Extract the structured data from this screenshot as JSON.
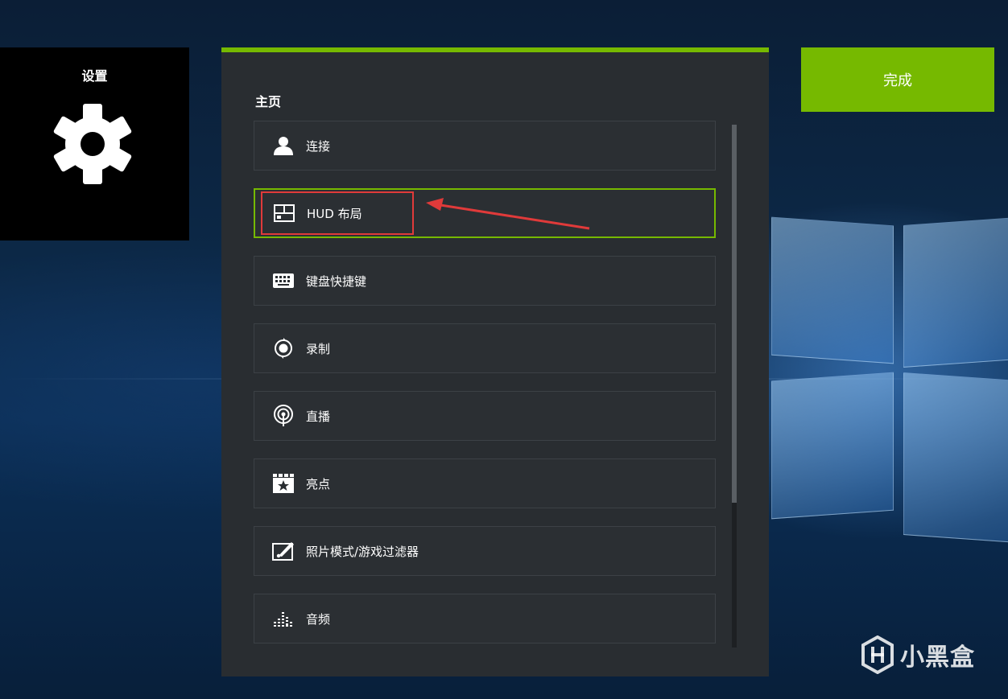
{
  "settings_tile": {
    "title": "设置",
    "icon": "gear-icon"
  },
  "done_button": {
    "label": "完成"
  },
  "panel": {
    "title": "主页",
    "accent_color": "#76b900",
    "items": [
      {
        "label": "连接",
        "icon": "user-icon"
      },
      {
        "label": "HUD 布局",
        "icon": "hud-layout-icon",
        "selected": true
      },
      {
        "label": "键盘快捷键",
        "icon": "keyboard-icon"
      },
      {
        "label": "录制",
        "icon": "record-icon"
      },
      {
        "label": "直播",
        "icon": "broadcast-icon"
      },
      {
        "label": "亮点",
        "icon": "highlights-icon"
      },
      {
        "label": "照片模式/游戏过滤器",
        "icon": "photo-mode-icon"
      },
      {
        "label": "音频",
        "icon": "audio-icon"
      }
    ]
  },
  "annotation": {
    "box_color": "#e03a3a"
  },
  "watermark": {
    "text": "小黑盒"
  }
}
